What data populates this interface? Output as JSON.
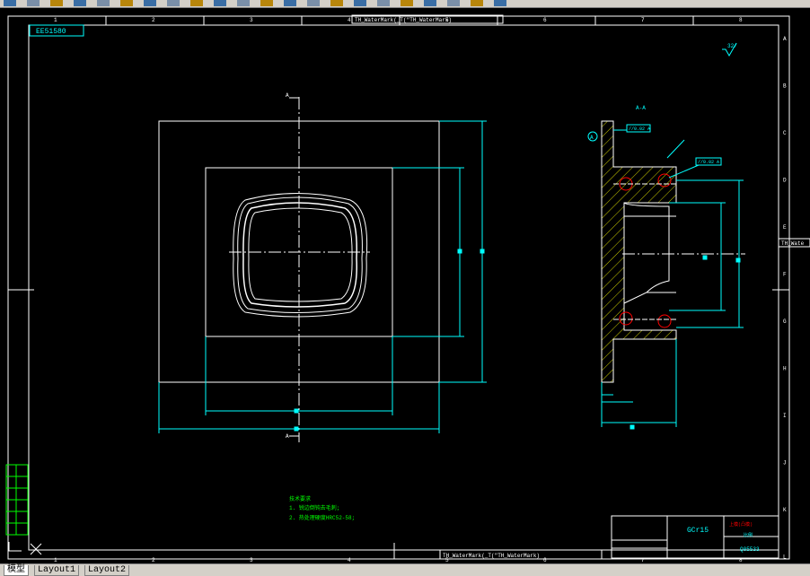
{
  "toolbar": {
    "buttons": [
      "new-icon",
      "open-icon",
      "save-icon",
      "print-icon",
      "preview-icon",
      "cut-icon",
      "copy-icon",
      "paste-icon",
      "undo-icon",
      "redo-icon",
      "pan-icon",
      "zoom-realtime-icon",
      "zoom-window-icon",
      "zoom-previous-icon",
      "properties-icon",
      "design-center-icon",
      "tool-palette-icon",
      "layer-icon",
      "bulb-icon",
      "sun-icon",
      "lock-icon",
      "color-icon"
    ]
  },
  "frame": {
    "col_numbers": [
      "1",
      "2",
      "3",
      "4",
      "5",
      "6",
      "7",
      "8"
    ],
    "row_letters": [
      "A",
      "B",
      "C",
      "D",
      "E",
      "F",
      "G",
      "H",
      "I",
      "J",
      "K",
      "L"
    ],
    "drawing_number_box": "EE51580",
    "watermark_top": "TH_WaterMark(_T(\"TH_WaterMark)",
    "watermark_bottom": "TH_WaterMark(_T(\"TH_WaterMark)",
    "watermark_side": "TH_Wate"
  },
  "annotations": {
    "section_mark": "A",
    "section_title": "A-A",
    "roughness": "32/",
    "tolerance_1": "//0.02 A",
    "tolerance_2": "//0.02 A",
    "datum": "A"
  },
  "notes": {
    "title": "技术要求",
    "line1": "1. 锐边倒钝去毛刺;",
    "line2": "2. 热处理硬度HRC52-58;"
  },
  "title_block": {
    "material": "GCr15",
    "part_name": "上模(凸模)",
    "scale": "比例",
    "drawing_no": "Q05533"
  },
  "tabs": [
    {
      "label": "模型",
      "active": true
    },
    {
      "label": "Layout1",
      "active": false
    },
    {
      "label": "Layout2",
      "active": false
    }
  ],
  "colors": {
    "frame": "#ffffff",
    "dimension": "#00ffff",
    "notes": "#00ff00",
    "hatch": "#ffff00",
    "hole": "#ff0000"
  }
}
